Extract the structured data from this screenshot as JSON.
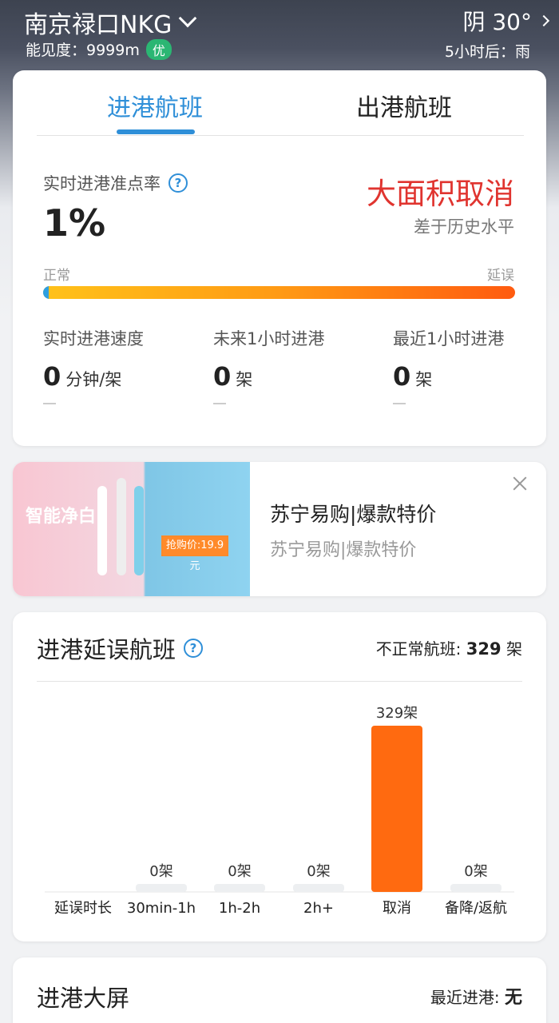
{
  "header": {
    "airport": "南京禄口NKG",
    "visibility_label": "能见度：9999m",
    "visibility_badge": "优",
    "weather": "阴 30°",
    "forecast": "5小时后：雨"
  },
  "tabs": [
    {
      "label": "进港航班",
      "active": true
    },
    {
      "label": "出港航班",
      "active": false
    }
  ],
  "ontime": {
    "label": "实时进港准点率",
    "value": "1%",
    "status": "大面积取消",
    "status_sub": "差于历史水平",
    "scale_left": "正常",
    "scale_right": "延误",
    "level_fraction": 0.01,
    "accent_color": "#2f8fd8",
    "status_color": "#e0342f"
  },
  "stats": [
    {
      "label": "实时进港速度",
      "value": "0",
      "unit": "分钟/架"
    },
    {
      "label": "未来1小时进港",
      "value": "0",
      "unit": "架"
    },
    {
      "label": "最近1小时进港",
      "value": "0",
      "unit": "架"
    }
  ],
  "ad": {
    "image_text": "智能净白",
    "image_price": "抢购价:19.9元",
    "title": "苏宁易购|爆款特价",
    "subtitle": "苏宁易购|爆款特价"
  },
  "delay": {
    "title": "进港延误航班",
    "summary_label": "不正常航班:",
    "summary_value": "329",
    "summary_unit": "架"
  },
  "chart_data": {
    "type": "bar",
    "x_label": "延误时长",
    "categories": [
      "30min-1h",
      "1h-2h",
      "2h+",
      "取消",
      "备降/返航"
    ],
    "values": [
      0,
      0,
      0,
      329,
      0
    ],
    "data_labels": [
      "0架",
      "0架",
      "0架",
      "329架",
      "0架"
    ],
    "ylim": [
      0,
      329
    ],
    "colors": {
      "bar": "#ff6a10",
      "empty": "#edeff1"
    }
  },
  "board": {
    "title": "进港大屏",
    "recent_label": "最近进港:",
    "recent_value": "无"
  }
}
